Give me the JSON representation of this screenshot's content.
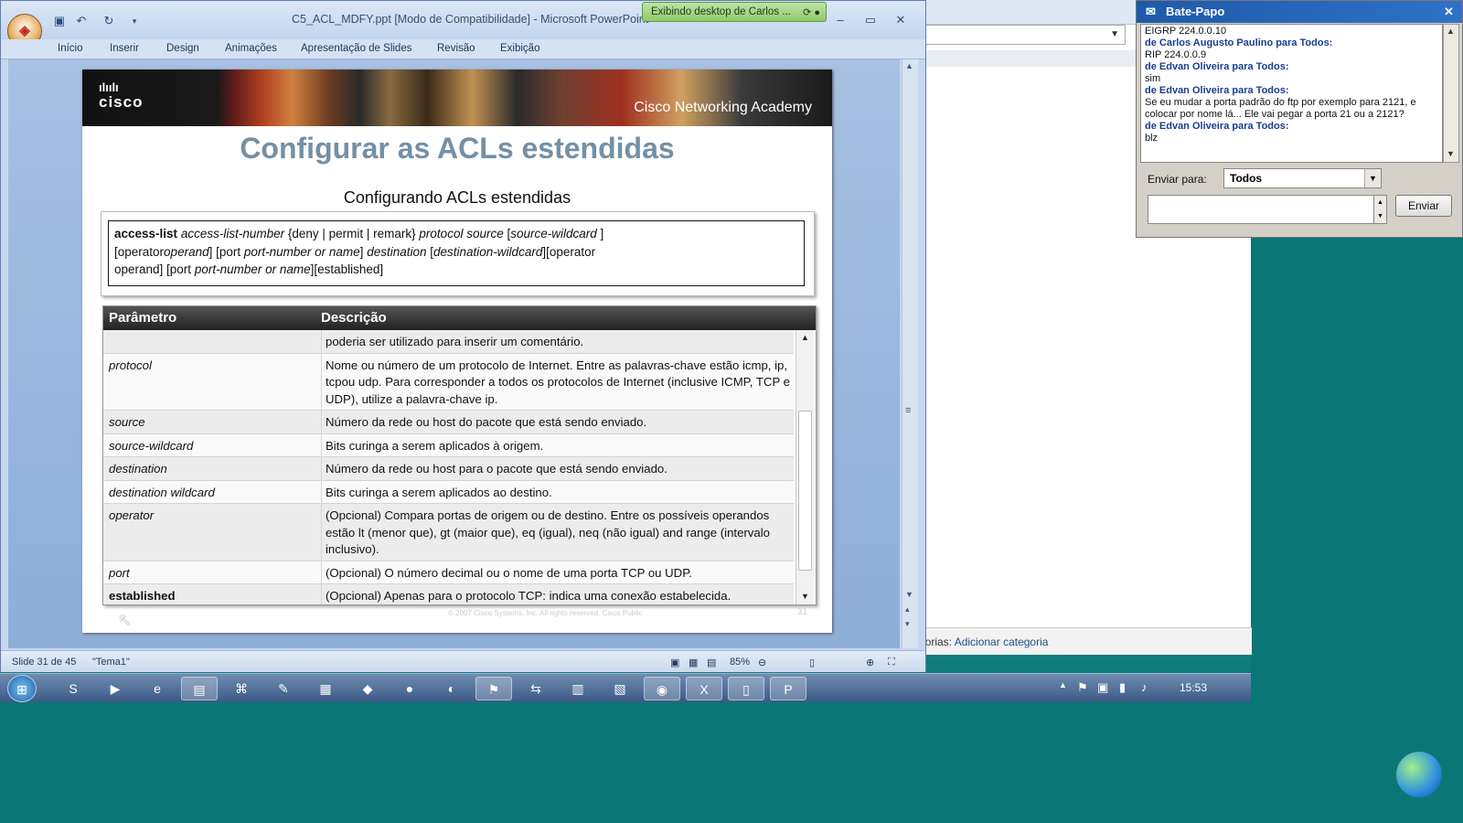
{
  "window": {
    "title": "C5_ACL_MDFY.ppt [Modo de Compatibilidade] - Microsoft PowerPoint"
  },
  "ribbon": {
    "tabs": [
      "Início",
      "Inserir",
      "Design",
      "Animações",
      "Apresentação de Slides",
      "Revisão",
      "Exibição"
    ]
  },
  "sharing": {
    "label": "Exibindo desktop de Carlos ..."
  },
  "slide": {
    "brand": "cisco",
    "academy": "Cisco Networking Academy",
    "title": "Configurar as ACLs estendidas",
    "subtitle": "Configurando ACLs estendidas",
    "syntax": {
      "l1a": "access-list ",
      "l1b": "access-list-number",
      "l1c": " {deny | permit | remark} ",
      "l1d": "protocol source",
      "l1e": " [",
      "l1f": "source-wildcard",
      "l1g": " ]",
      "l2a": "[operator",
      "l2b": "operand",
      "l2c": "] [port  ",
      "l2d": "port-number or name",
      "l2e": "]  ",
      "l2f": "destination",
      "l2g": " [",
      "l2h": "destination-wildcard",
      "l2i": "][operator",
      "l3a": "operand] [port ",
      "l3b": "port-number or name",
      "l3c": "][established]"
    },
    "table": {
      "headers": [
        "Parâmetro",
        "Descrição"
      ],
      "rows": [
        {
          "param": "",
          "desc": "poderia ser utilizado para inserir um comentário."
        },
        {
          "param": "protocol",
          "desc": "Nome ou número de um protocolo de Internet. Entre as palavras-chave estão icmp, ip, tcpou udp. Para corresponder a todos os protocolos de Internet (inclusive ICMP, TCP e UDP), utilize a palavra-chave ip."
        },
        {
          "param": "source",
          "desc": "Número da rede ou host do pacote que está sendo enviado."
        },
        {
          "param": "source-wildcard",
          "desc": "Bits curinga a serem aplicados à origem."
        },
        {
          "param": "destination",
          "desc": "Número da rede ou host para o pacote que está sendo enviado."
        },
        {
          "param": "destination wildcard",
          "desc": "Bits curinga a serem aplicados ao destino."
        },
        {
          "param": "operator",
          "desc": "(Opcional) Compara portas de origem ou de destino. Entre os possíveis operandos estão lt (menor que), gt (maior que), eq (igual), neq (não igual) and range (intervalo inclusivo)."
        },
        {
          "param": "port",
          "desc": "(Opcional) O número decimal ou o nome de uma porta TCP ou UDP."
        },
        {
          "param": "established",
          "desc": "(Opcional) Apenas para o protocolo TCP: indica uma conexão estabelecida."
        }
      ]
    },
    "footer": "© 2007 Cisco Systems, Inc. All rights reserved.        Cisco Public",
    "page_number": "31"
  },
  "status": {
    "slide": "Slide 31 de 45",
    "theme": "\"Tema1\"",
    "zoom": "85%"
  },
  "background_window": {
    "footer_prefix": "gorias:",
    "footer_link": "Adicionar categoria"
  },
  "chat": {
    "title": "Bate-Papo",
    "messages": [
      {
        "kind": "text",
        "text": "EIGRP 224.0.0.10"
      },
      {
        "kind": "who",
        "text": "de Carlos Augusto Paulino para Todos:"
      },
      {
        "kind": "text",
        "text": "RIP 224.0.0.9"
      },
      {
        "kind": "who",
        "text": "de Edvan Oliveira para Todos:"
      },
      {
        "kind": "text",
        "text": "sim"
      },
      {
        "kind": "who",
        "text": "de Edvan Oliveira para Todos:"
      },
      {
        "kind": "text",
        "text": "Se eu mudar a porta padrão do ftp por exemplo para 2121, e colocar por nome lá... Ele vai pegar a porta 21 ou a 2121?"
      },
      {
        "kind": "who",
        "text": "de Edvan Oliveira para Todos:"
      },
      {
        "kind": "text",
        "text": "blz"
      }
    ],
    "send_to_label": "Enviar para:",
    "send_to_value": "Todos",
    "send_button": "Enviar"
  },
  "taskbar": {
    "clock": "15:53"
  }
}
